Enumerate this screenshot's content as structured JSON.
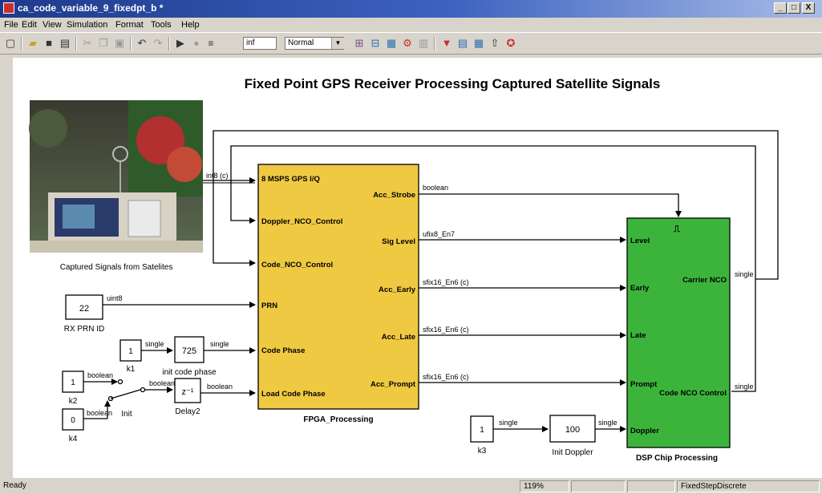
{
  "window": {
    "title": "ca_code_variable_9_fixedpt_b *",
    "controls": [
      "_",
      "□",
      "X"
    ]
  },
  "menu": [
    "File",
    "Edit",
    "View",
    "Simulation",
    "Format",
    "Tools",
    "Help"
  ],
  "toolbar": {
    "stop_time": "inf",
    "sim_mode": "Normal",
    "mode_arrow": "▼"
  },
  "model": {
    "title": "Fixed Point GPS Receiver Processing Captured Satellite Signals",
    "image_caption": "Captured Signals from Satelites",
    "fpga": {
      "name": "FPGA_Processing",
      "inputs": [
        "8 MSPS GPS I/Q",
        "Doppler_NCO_Control",
        "Code_NCO_Control",
        "PRN",
        "Code Phase",
        "Load Code Phase"
      ],
      "outputs": [
        "Acc_Strobe",
        "Sig Level",
        "Acc_Early",
        "Acc_Late",
        "Acc_Prompt"
      ]
    },
    "dsp": {
      "name": "DSP Chip Processing",
      "inputs": [
        "Level",
        "Early",
        "Late",
        "Prompt",
        "Doppler"
      ],
      "outputs": [
        "Carrier NCO",
        "Code NCO Control"
      ]
    },
    "blocks": {
      "prn": {
        "value": "22",
        "label": "RX PRN ID"
      },
      "k1": {
        "value": "1",
        "label": "k1"
      },
      "init_code_phase": {
        "value": "725",
        "label": "init code phase"
      },
      "k2": {
        "value": "1",
        "label": "k2"
      },
      "k4": {
        "value": "0",
        "label": "k4"
      },
      "switch": {
        "label": "Init"
      },
      "delay": {
        "value": "z⁻¹",
        "label": "Delay2"
      },
      "k3": {
        "value": "1",
        "label": "k3"
      },
      "init_doppler": {
        "value": "100",
        "label": "Init Doppler"
      }
    },
    "signals": {
      "iq": "int8 (c)",
      "strobe": "boolean",
      "level": "ufix8_En7",
      "early": "sfix16_En6 (c)",
      "late": "sfix16_En6 (c)",
      "prompt": "sfix16_En6 (c)",
      "prn": "uint8",
      "k1": "single",
      "codephase": "single",
      "k2": "boolean",
      "k4": "boolean",
      "switch_out": "boolean",
      "load": "boolean",
      "k3": "single",
      "doppler": "single",
      "carrier_nco": "single",
      "code_nco": "single"
    }
  },
  "status": {
    "left": "Ready",
    "zoom": "119%",
    "solver": "FixedStepDiscrete"
  },
  "colors": {
    "fpga": "#f0c942",
    "dsp": "#3cb43c",
    "title_gradient_start": "#1e3a8c"
  }
}
